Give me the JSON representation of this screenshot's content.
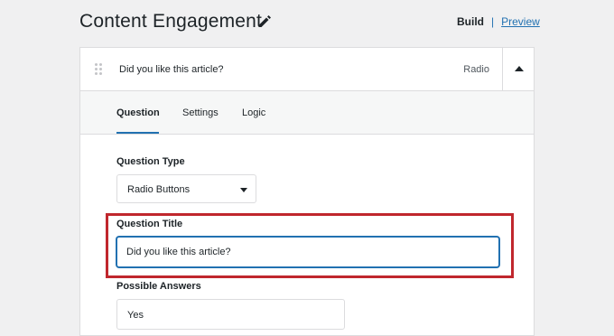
{
  "page": {
    "title": "Content Engagement",
    "edit_icon": "pencil-icon",
    "build_label": "Build",
    "separator": "|",
    "preview_label": "Preview"
  },
  "question": {
    "title": "Did you like this article?",
    "type": "Radio",
    "drag_icon": "drag-handle-icon",
    "collapse_icon": "chevron-up-icon"
  },
  "tabs": [
    {
      "label": "Question",
      "active": true
    },
    {
      "label": "Settings",
      "active": false
    },
    {
      "label": "Logic",
      "active": false
    }
  ],
  "form": {
    "question_type_label": "Question Type",
    "question_type_value": "Radio Buttons",
    "question_title_label": "Question Title",
    "question_title_value": "Did you like this article?",
    "possible_answers_label": "Possible Answers",
    "answers": [
      "Yes"
    ]
  },
  "colors": {
    "accent": "#2271b1",
    "highlight": "#c0272d",
    "background": "#f0f0f1"
  }
}
